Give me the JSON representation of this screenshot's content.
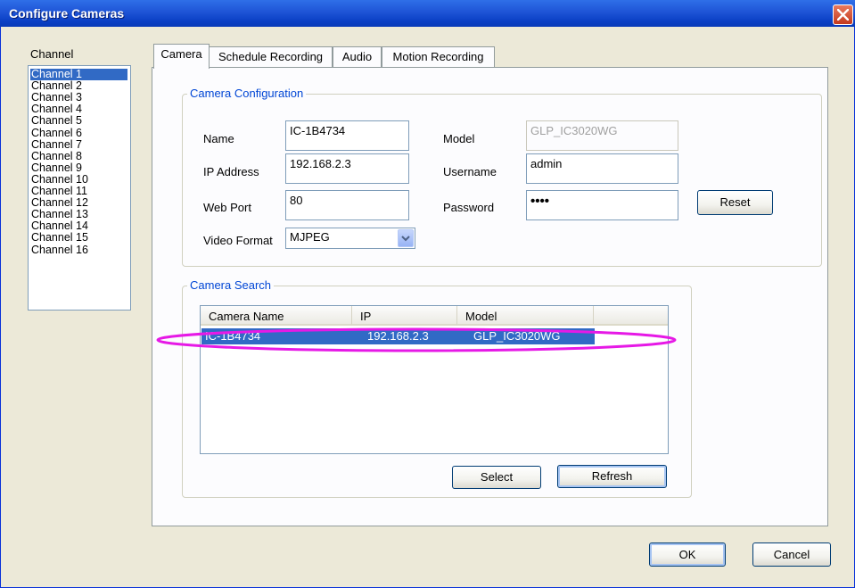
{
  "window": {
    "title": "Configure Cameras"
  },
  "channel": {
    "label": "Channel",
    "items": [
      "Channel 1",
      "Channel 2",
      "Channel 3",
      "Channel 4",
      "Channel 5",
      "Channel 6",
      "Channel 7",
      "Channel 8",
      "Channel 9",
      "Channel 10",
      "Channel 11",
      "Channel 12",
      "Channel 13",
      "Channel 14",
      "Channel 15",
      "Channel 16"
    ],
    "selected": "Channel 1"
  },
  "tabs": [
    "Camera",
    "Schedule Recording",
    "Audio",
    "Motion Recording"
  ],
  "camera_config": {
    "title": "Camera Configuration",
    "name_label": "Name",
    "name_value": "IC-1B4734",
    "ip_label": "IP Address",
    "ip_value": "192.168.2.3",
    "port_label": "Web Port",
    "port_value": "80",
    "format_label": "Video Format",
    "format_value": "MJPEG",
    "model_label": "Model",
    "model_value": "GLP_IC3020WG",
    "username_label": "Username",
    "username_value": "admin",
    "password_label": "Password",
    "password_value": "••••",
    "reset_label": "Reset"
  },
  "camera_search": {
    "title": "Camera Search",
    "columns": [
      "Camera Name",
      "IP",
      "Model"
    ],
    "rows": [
      {
        "name": "IC-1B4734",
        "ip": "192.168.2.3",
        "model": "GLP_IC3020WG"
      }
    ],
    "select_label": "Select",
    "refresh_label": "Refresh"
  },
  "footer": {
    "ok_label": "OK",
    "cancel_label": "Cancel"
  },
  "colors": {
    "selection": "#316ac5",
    "annotation": "#e619e6",
    "titlebar": "#0a3fc4"
  }
}
